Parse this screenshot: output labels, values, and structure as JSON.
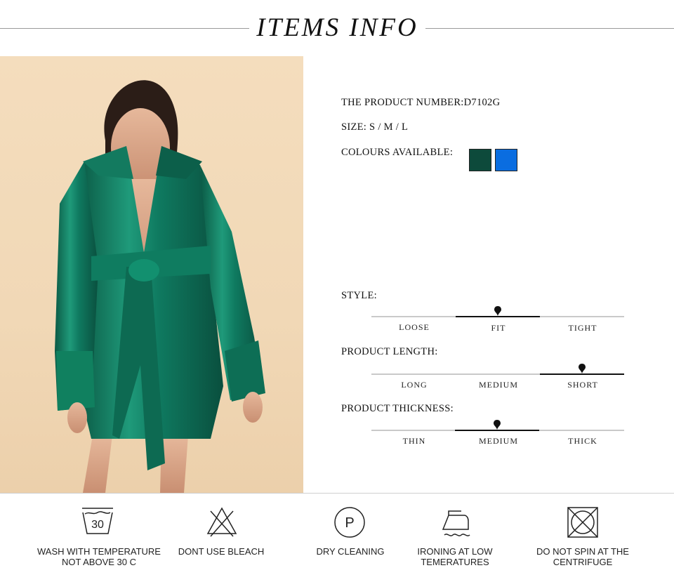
{
  "header": {
    "title": "ITEMS INFO"
  },
  "product": {
    "number_label": "THE PRODUCT NUMBER:D7102G",
    "size_label": "SIZE: S / M / L",
    "colours_label": "COLOURS AVAILABLE:",
    "colours": [
      "#0d4a3b",
      "#0a6de0"
    ]
  },
  "scales": {
    "style": {
      "title": "STYLE:",
      "options": [
        "LOOSE",
        "FIT",
        "TIGHT"
      ],
      "selected": "FIT"
    },
    "length": {
      "title": "PRODUCT LENGTH:",
      "options": [
        "LONG",
        "MEDIUM",
        "SHORT"
      ],
      "selected": "SHORT"
    },
    "thickness": {
      "title": "PRODUCT THICKNESS:",
      "options": [
        "THIN",
        "MEDIUM",
        "THICK"
      ],
      "selected": "MEDIUM"
    }
  },
  "care": [
    {
      "icon": "wash-30-icon",
      "number": "30",
      "label": "WASH WITH TEMPERATURE NOT ABOVE 30 C"
    },
    {
      "icon": "no-bleach-icon",
      "label": "DONT USE BLEACH"
    },
    {
      "icon": "dry-clean-icon",
      "letter": "P",
      "label": "DRY CLEANING"
    },
    {
      "icon": "iron-low-icon",
      "label": "IRONING AT LOW TEMERATURES"
    },
    {
      "icon": "no-spin-icon",
      "label": "DO NOT SPIN AT THE CENTRIFUGE"
    }
  ]
}
